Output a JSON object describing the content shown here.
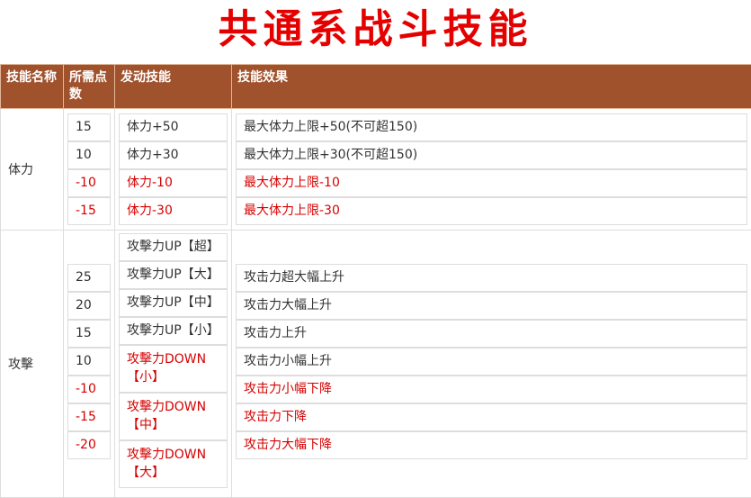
{
  "title": "共通系战斗技能",
  "headers": [
    "技能名称",
    "所需点数",
    "发动技能",
    "技能效果"
  ],
  "groups": [
    {
      "name": "体力",
      "points": [
        "15",
        "10",
        "-10",
        "-15"
      ],
      "skills": [
        "体力+50",
        "体力+30",
        "体力-10",
        "体力-30"
      ],
      "effects": [
        "最大体力上限+50(不可超150)",
        "最大体力上限+30(不可超150)",
        "最大体力上限-10",
        "最大体力上限-30"
      ]
    },
    {
      "name": "攻擊",
      "points": [
        "25",
        "20",
        "15",
        "10",
        "-10",
        "-15",
        "-20"
      ],
      "skills": [
        "攻擊力UP【超】",
        "攻擊力UP【大】",
        "攻擊力UP【中】",
        "攻擊力UP【小】",
        "攻擊力DOWN【小】",
        "攻擊力DOWN【中】",
        "攻擊力DOWN【大】"
      ],
      "effects": [
        "攻击力超大幅上升",
        "攻击力大幅上升",
        "攻击力上升",
        "攻击力小幅上升",
        "攻击力小幅下降",
        "攻击力下降",
        "攻击力大幅下降"
      ]
    }
  ],
  "colors": {
    "header_bg": "#a0522d",
    "title": "#e50000",
    "negative": "#d60000"
  }
}
